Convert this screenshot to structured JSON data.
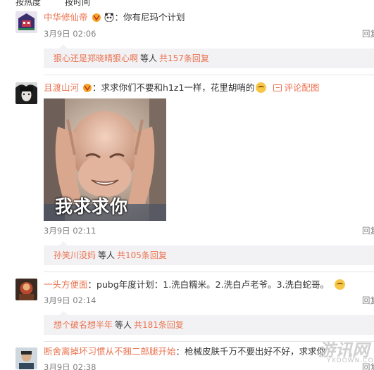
{
  "top_partial": {
    "left": "按热度",
    "right": "按时间"
  },
  "comments": [
    {
      "username": "中华修仙帝",
      "text": "你有尼玛个计划",
      "time": "3月9日 02:06",
      "reply": "回复",
      "sub": {
        "name": "狠心还是郑晓晴狠心啊",
        "mid": "等人",
        "count": "共157条回复"
      }
    },
    {
      "username": "且渡山河",
      "text": "求求你们不要和h1z1一样，花里胡哨的",
      "pic_link": "评论配图",
      "meme_caption": "我求求你",
      "time": "3月9日 02:11",
      "reply": "回复",
      "sub": {
        "name": "孙笑川没妈",
        "mid": "等人",
        "count": "共105条回复"
      }
    },
    {
      "username": "一头方便面",
      "text": "pubg年度计划：1.洗白糯米。2.洗白卢老爷。3.洗白蛇哥。",
      "time": "3月9日 02:14",
      "reply": "回复",
      "sub": {
        "name": "想个破名想半年",
        "mid": "等人",
        "count": "共181条回复"
      }
    },
    {
      "username": "断舍离掉坏习惯从不翘二郎腿开始",
      "text": "枪械皮肤千万不要出好不好，求求你",
      "time": "3月9日 02:38",
      "reply": "回复"
    }
  ],
  "watermark": {
    "main": "游讯网",
    "sub": "YXDOWN.COM"
  },
  "colors": {
    "link": "#eb7350",
    "sub_bg": "#f2f2f5",
    "time": "#808080"
  }
}
